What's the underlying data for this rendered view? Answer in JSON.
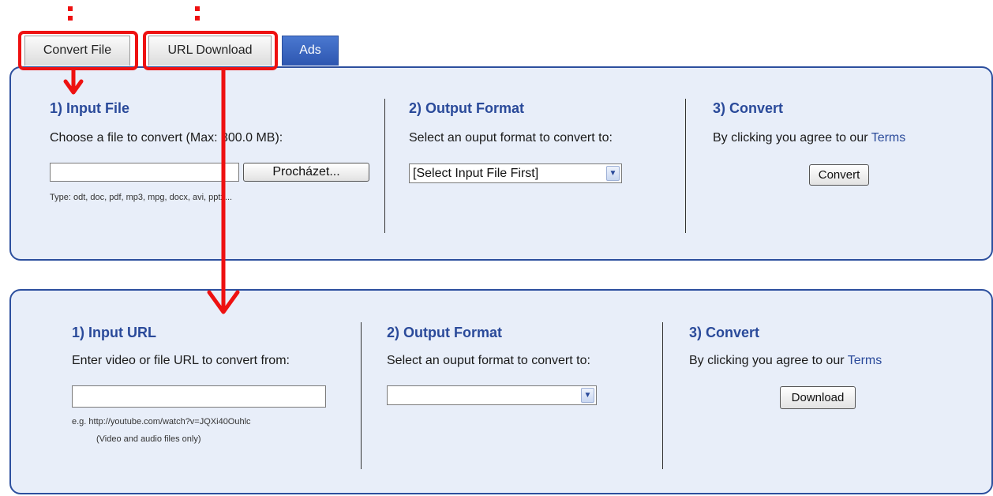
{
  "tabs": [
    {
      "label": "Convert File"
    },
    {
      "label": "URL Download"
    },
    {
      "label": "Ads"
    }
  ],
  "file_panel": {
    "input": {
      "heading": "1) Input File",
      "description": "Choose a file to convert (Max: 300.0 MB):",
      "browse_label": "Procházet...",
      "types_hint": "Type: odt, doc, pdf, mp3, mpg, docx, avi, pptx..."
    },
    "output": {
      "heading": "2) Output Format",
      "description": "Select an ouput format to convert to:",
      "select_value": "[Select Input File First]"
    },
    "convert": {
      "heading": "3) Convert",
      "description_prefix": "By clicking you agree to our",
      "terms_label": "Terms",
      "button_label": "Convert"
    }
  },
  "url_panel": {
    "input": {
      "heading": "1) Input URL",
      "description": "Enter video or file URL to convert from:",
      "example_hint": "e.g. http://youtube.com/watch?v=JQXi40Ouhlc",
      "note_hint": "(Video and audio files only)"
    },
    "output": {
      "heading": "2) Output Format",
      "description": "Select an ouput format to convert to:",
      "select_value": ""
    },
    "convert": {
      "heading": "3) Convert",
      "description_prefix": "By clicking you agree to our",
      "terms_label": "Terms",
      "button_label": "Download"
    }
  },
  "annotation": {
    "color": "#ee1111"
  }
}
